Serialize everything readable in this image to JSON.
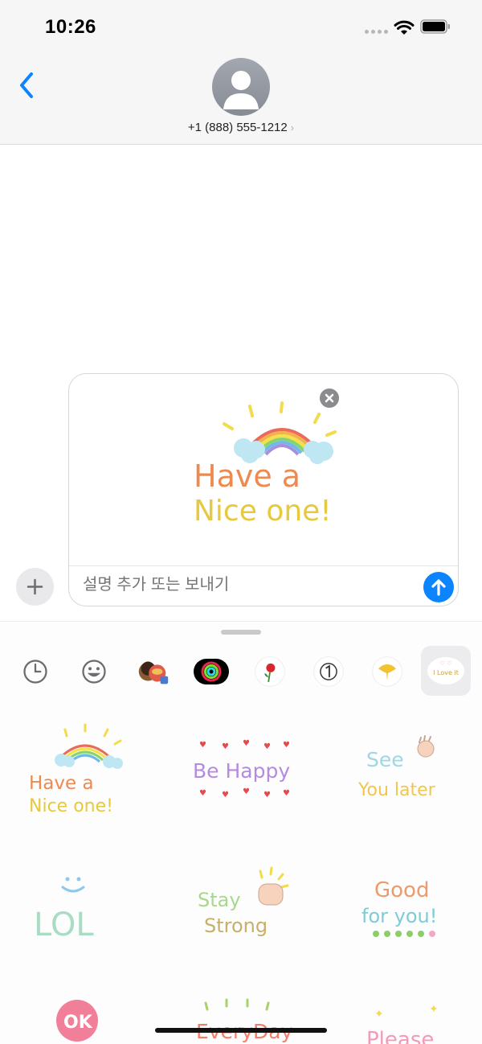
{
  "status_bar": {
    "time": "10:26"
  },
  "header": {
    "contact_number": "+1 (888) 555-1212",
    "chevron": "›"
  },
  "compose": {
    "preview_sticker": {
      "line1": "Have a",
      "line2": "Nice one!"
    },
    "caption_placeholder": "설명 추가 또는 보내기"
  },
  "app_strip": {
    "apps": [
      {
        "name": "recents-icon"
      },
      {
        "name": "emoji-stickers-icon"
      },
      {
        "name": "memoji-icon"
      },
      {
        "name": "activity-icon"
      },
      {
        "name": "rose-sticker-icon"
      },
      {
        "name": "number-one-icon"
      },
      {
        "name": "ginkgo-leaf-icon"
      },
      {
        "name": "i-love-it-pack-icon",
        "label": "I Love it"
      }
    ]
  },
  "stickers": [
    {
      "line1": "Have a",
      "line2": "Nice one!"
    },
    {
      "line1": "Be Happy"
    },
    {
      "line1": "See",
      "line2": "You later"
    },
    {
      "line1": "LOL"
    },
    {
      "line1": "Stay",
      "line2": "Strong"
    },
    {
      "line1": "Good",
      "line2": "for you!"
    },
    {
      "line1": "OK"
    },
    {
      "line1": "EveryDay"
    },
    {
      "line1": "Please"
    }
  ],
  "colors": {
    "accent": "#0a84ff",
    "grey_bar": "#f6f6f6"
  }
}
